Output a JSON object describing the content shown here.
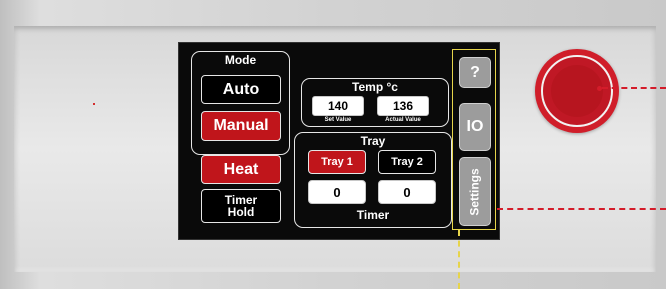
{
  "mode": {
    "title": "Mode",
    "auto_label": "Auto",
    "manual_label": "Manual"
  },
  "heat_label": "Heat",
  "timer_hold": {
    "line1": "Timer",
    "line2": "Hold"
  },
  "temp": {
    "title": "Temp °c",
    "set_value": "140",
    "set_label": "Set Value",
    "actual_value": "136",
    "actual_label": "Actual Value"
  },
  "tray": {
    "title": "Tray",
    "tray1_label": "Tray 1",
    "tray2_label": "Tray 2",
    "tray1_timer": "0",
    "tray2_timer": "0",
    "timer_label": "Timer"
  },
  "side": {
    "help_label": "?",
    "io_label": "IO",
    "settings_label": "Settings"
  },
  "colors": {
    "accent_red": "#c0151b",
    "knob_red": "#d01e2a",
    "callout_yellow": "#e6d44a",
    "callout_red": "#d41c2a"
  }
}
